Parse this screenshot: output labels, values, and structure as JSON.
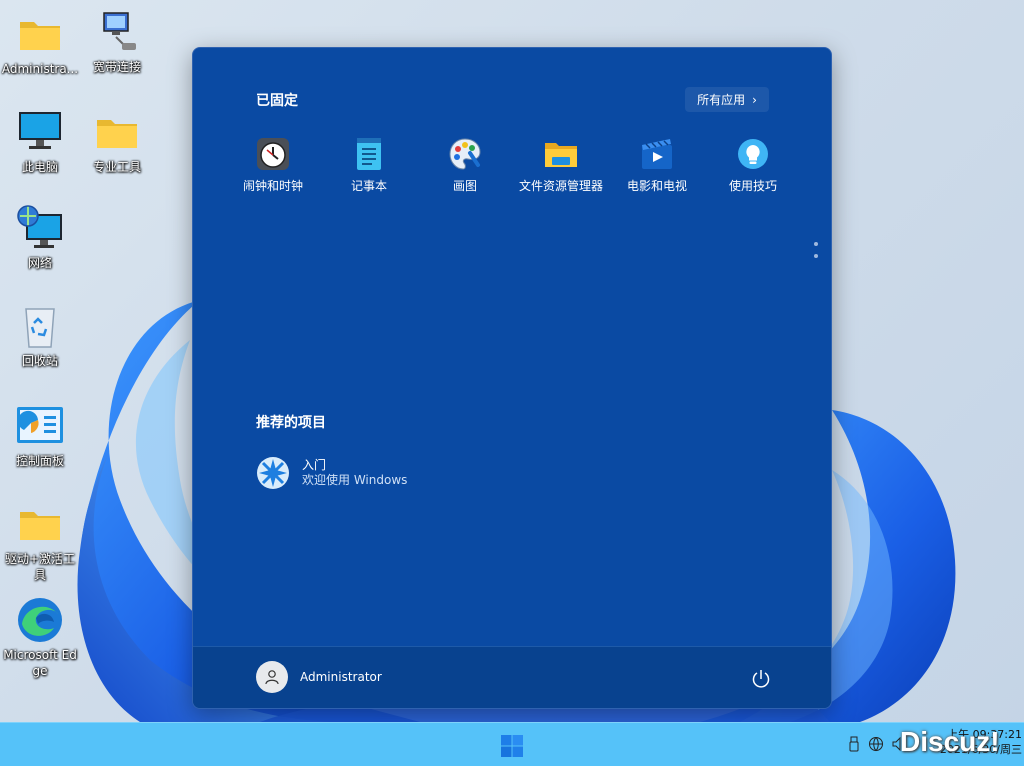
{
  "desktop": {
    "icons": [
      {
        "label": "Administra..."
      },
      {
        "label": "宽带连接"
      },
      {
        "label": "此电脑"
      },
      {
        "label": "专业工具"
      },
      {
        "label": "网络"
      },
      {
        "label": "回收站"
      },
      {
        "label": "控制面板"
      },
      {
        "label": "驱动+激活工具"
      },
      {
        "label": "Microsoft Edge"
      }
    ]
  },
  "start_menu": {
    "pinned_title": "已固定",
    "all_apps_label": "所有应用",
    "pinned_apps": [
      {
        "label": "闹钟和时钟",
        "icon": "clock-icon"
      },
      {
        "label": "记事本",
        "icon": "notepad-icon"
      },
      {
        "label": "画图",
        "icon": "paint-icon"
      },
      {
        "label": "文件资源管理器",
        "icon": "folder-icon"
      },
      {
        "label": "电影和电视",
        "icon": "movies-icon"
      },
      {
        "label": "使用技巧",
        "icon": "tips-icon"
      }
    ],
    "recommended_title": "推荐的项目",
    "recommended": [
      {
        "title": "入门",
        "subtitle": "欢迎使用 Windows",
        "icon": "get-started-icon"
      }
    ],
    "user_name": "Administrator"
  },
  "taskbar": {
    "time": "上午 09:37:21",
    "date": "2021/6/30/周三"
  },
  "watermark": "Discuz!",
  "colors": {
    "start_menu_bg": "#0a4aa3",
    "taskbar_bg": "#55c2f9",
    "wallpaper_bloom": "#1f6ff0"
  }
}
